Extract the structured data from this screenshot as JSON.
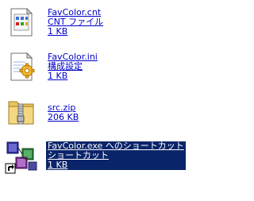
{
  "files": [
    {
      "name": "FavColor.cnt",
      "type": "CNT ファイル",
      "size": "1 KB",
      "icon": "cnt-file-icon"
    },
    {
      "name": "FavColor.ini",
      "type": "構成設定",
      "size": "1 KB",
      "icon": "ini-settings-icon"
    },
    {
      "name": "src.zip",
      "type": "",
      "size": "206 KB",
      "icon": "zip-folder-icon"
    },
    {
      "name": "FavColor.exe へのショートカット",
      "type": "ショートカット",
      "size": "1 KB",
      "icon": "shortcut-app-icon",
      "selected": true
    }
  ],
  "colors": {
    "link": "#0000cc",
    "selection": "#0a246a",
    "selection_text": "#ffffff"
  }
}
